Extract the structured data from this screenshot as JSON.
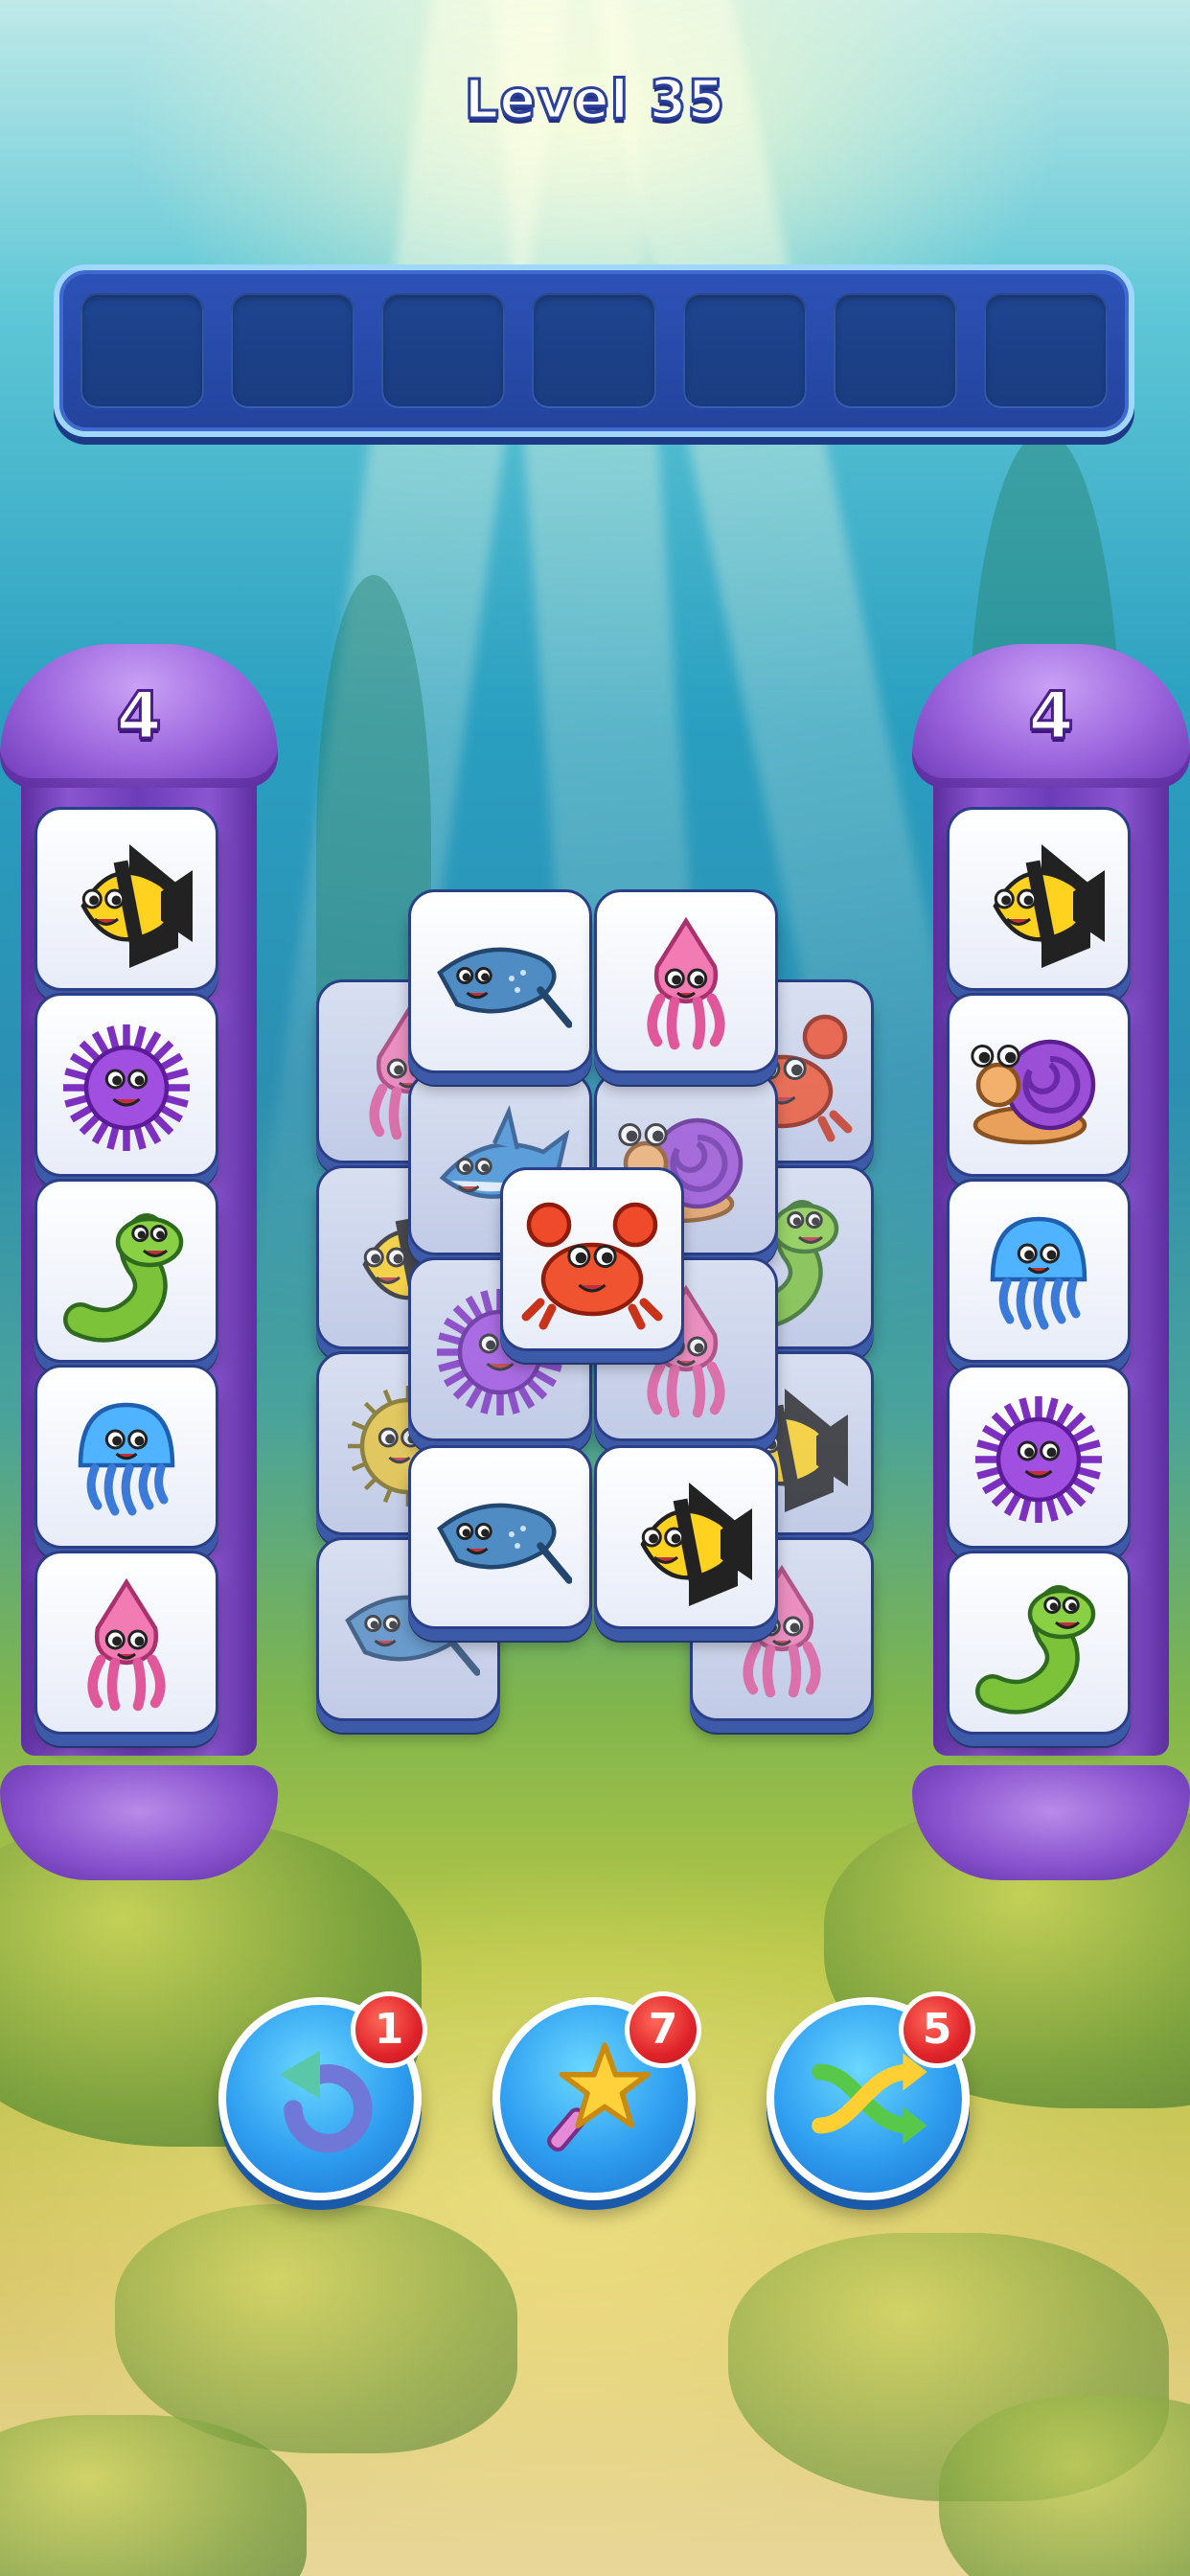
{
  "level": {
    "title": "Level 35"
  },
  "slot_tray": {
    "capacity": 7,
    "filled": 0
  },
  "left_pillar": {
    "count": "4",
    "tiles": [
      "angelfish",
      "sea-urchin",
      "eel",
      "jellyfish",
      "squid"
    ]
  },
  "right_pillar": {
    "count": "4",
    "tiles": [
      "angelfish",
      "snail",
      "jellyfish",
      "sea-urchin",
      "eel"
    ]
  },
  "board": {
    "tiles": [
      {
        "type": "squid",
        "covered": true
      },
      {
        "type": "angelfish",
        "covered": true
      },
      {
        "type": "pufferfish",
        "covered": true
      },
      {
        "type": "stingray",
        "covered": true
      },
      {
        "type": "crab",
        "covered": true
      },
      {
        "type": "eel",
        "covered": true
      },
      {
        "type": "angelfish",
        "covered": true
      },
      {
        "type": "squid",
        "covered": true
      },
      {
        "type": "shark",
        "covered": true
      },
      {
        "type": "snail",
        "covered": true
      },
      {
        "type": "sea-urchin",
        "covered": true
      },
      {
        "type": "squid",
        "covered": true
      },
      {
        "type": "stingray",
        "covered": false
      },
      {
        "type": "squid",
        "covered": false
      },
      {
        "type": "stingray",
        "covered": false
      },
      {
        "type": "angelfish",
        "covered": false
      },
      {
        "type": "crab",
        "covered": false
      }
    ]
  },
  "powerups": [
    {
      "name": "undo",
      "icon": "undo-arrow-icon",
      "count": "1"
    },
    {
      "name": "magic-wand",
      "icon": "star-wand-icon",
      "count": "7"
    },
    {
      "name": "shuffle",
      "icon": "shuffle-icon",
      "count": "5"
    }
  ],
  "colors": {
    "tile_face": "#ffffff",
    "tile_edge": "#3d5aa8",
    "pillar_purple": "#8a55d0",
    "tray_blue": "#2d52b8",
    "badge_red": "#e0232a",
    "powerup_blue": "#2f9ef0"
  }
}
